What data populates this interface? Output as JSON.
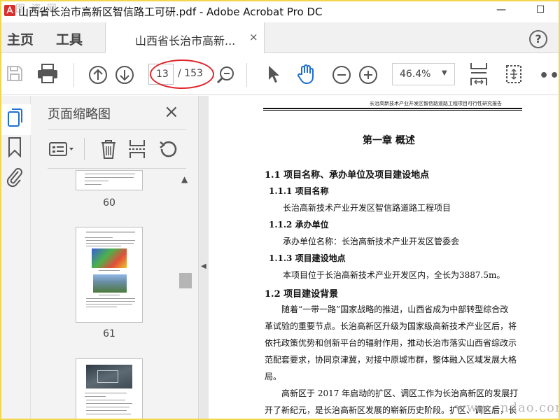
{
  "window": {
    "title": "山西省长治市高新区智信路工可研.pdf - Adobe Acrobat Pro DC",
    "minimize_glyph": "—",
    "maximize_glyph": "☐"
  },
  "watermarks": {
    "top_left": "图 资 网",
    "bottom_right": "www.cndao.com"
  },
  "menubar": {
    "home": "主页",
    "tools": "工具",
    "tab_label": "山西省长治市高新...",
    "tab_close": "×",
    "help": "?"
  },
  "toolbar": {
    "current_page": "13",
    "total_pages": "/ 153",
    "zoom": "46.4%",
    "more": "•••",
    "highlight_color": "#e0262a",
    "accent_color": "#1f6fd1"
  },
  "thumbnail_panel": {
    "title": "页面缩略图",
    "close": "×",
    "thumb_labels": [
      "60",
      "61"
    ]
  },
  "document": {
    "header": "长治高新技术产业开发区智信路道路工程项目可行性研究报告",
    "chapter": "第一章   概述",
    "lines": [
      "1.1 项目名称、承办单位及项目建设地点",
      "1.1.1 项目名称",
      "长治高新技术产业开发区智信路道路工程项目",
      "1.1.2 承办单位",
      "承办单位名称：长治高新技术产业开发区管委会",
      "1.1.3 项目建设地点",
      "本项目位于长治高新技术产业开发区内，全长为3887.5m。",
      "1.2 项目建设背景",
      "随着“一带一路”国家战略的推进，山西省成为中部转型综合改",
      "革试验的重要节点。长治高新区升级为国家级高新技术产业区后，将",
      "依托政策优势和创新平台的辐射作用，推动长治市落实山西省综改示",
      "范配套要求，协同京津冀，对接中原城市群，整体融入区域发展大格",
      "局。",
      "高新区于  2017  年启动的扩区、调区工作为长治高新区的发展打",
      "开了新纪元，是长治高新区发展的崭新历史阶段。扩区、调区后，长"
    ]
  }
}
